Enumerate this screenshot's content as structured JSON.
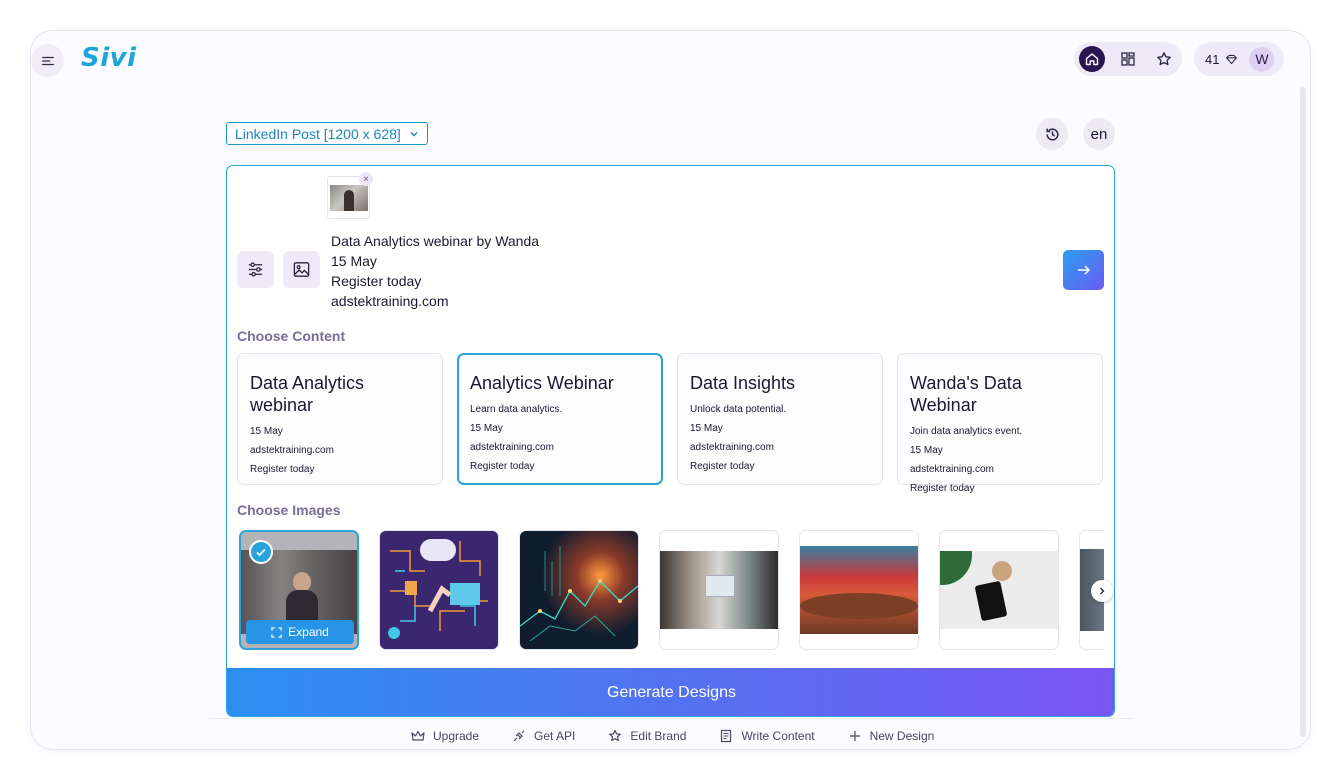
{
  "header": {
    "logo_text": "Sivi",
    "credits": "41",
    "avatar_initial": "W",
    "icons": [
      "menu-icon",
      "home-icon",
      "grid-icon",
      "star-icon",
      "gem-icon"
    ]
  },
  "toolbar": {
    "format_label": "LinkedIn Post [1200 x 628]",
    "language": "en"
  },
  "prompt": {
    "lines": [
      "Data Analytics webinar by Wanda",
      "15 May",
      "Register today",
      "adstektraining.com"
    ],
    "thumb_remove": "×"
  },
  "content_section": {
    "title": "Choose Content",
    "cards": [
      {
        "title": "Data Analytics webinar",
        "lines": [
          "15 May",
          "adstektraining.com",
          "Register today"
        ]
      },
      {
        "title": "Analytics Webinar",
        "lines": [
          "Learn data analytics.",
          "15 May",
          "adstektraining.com",
          "Register today"
        ]
      },
      {
        "title": "Data Insights",
        "lines": [
          "Unlock data potential.",
          "15 May",
          "adstektraining.com",
          "Register today"
        ]
      },
      {
        "title": "Wanda's Data Webinar",
        "lines": [
          "Join data analytics event.",
          "15 May",
          "adstektraining.com",
          "Register today"
        ]
      }
    ],
    "selected_index": 1
  },
  "images_section": {
    "title": "Choose Images",
    "expand_label": "Expand",
    "selected_index": 0
  },
  "generate_label": "Generate Designs",
  "footer": {
    "items": [
      "Upgrade",
      "Get API",
      "Edit Brand",
      "Write Content",
      "New Design"
    ]
  },
  "colors": {
    "accent": "#2aa3d8",
    "primary_dark": "#2a1550",
    "gradient_start": "#2c8ff0",
    "gradient_end": "#7a55f2"
  }
}
